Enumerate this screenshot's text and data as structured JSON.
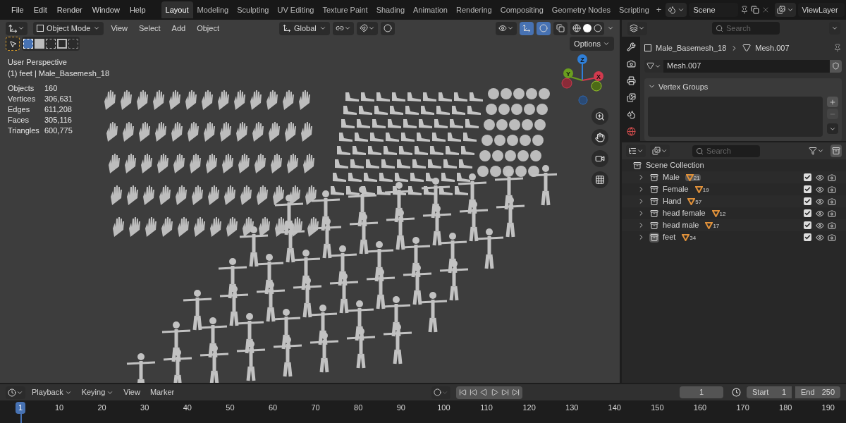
{
  "menus": [
    "File",
    "Edit",
    "Render",
    "Window",
    "Help"
  ],
  "workspaces": [
    {
      "label": "Layout",
      "selected": true
    },
    {
      "label": "Modeling",
      "selected": false
    },
    {
      "label": "Sculpting",
      "selected": false
    },
    {
      "label": "UV Editing",
      "selected": false
    },
    {
      "label": "Texture Paint",
      "selected": false
    },
    {
      "label": "Shading",
      "selected": false
    },
    {
      "label": "Animation",
      "selected": false
    },
    {
      "label": "Rendering",
      "selected": false
    },
    {
      "label": "Compositing",
      "selected": false
    },
    {
      "label": "Geometry Nodes",
      "selected": false
    },
    {
      "label": "Scripting",
      "selected": false
    }
  ],
  "add_workspace": "+",
  "scene": "Scene",
  "view_layer": "ViewLayer",
  "viewport": {
    "mode": "Object Mode",
    "menus": [
      "View",
      "Select",
      "Add",
      "Object"
    ],
    "orientation": "Global",
    "overlay": [
      "User Perspective",
      "(1) feet | Male_Basemesh_18"
    ],
    "stats": [
      {
        "label": "Objects",
        "value": "160"
      },
      {
        "label": "Vertices",
        "value": "306,631"
      },
      {
        "label": "Edges",
        "value": "611,208"
      },
      {
        "label": "Faces",
        "value": "305,116"
      },
      {
        "label": "Triangles",
        "value": "600,775"
      }
    ],
    "options": "Options",
    "gizmo_axes": [
      {
        "label": "Z",
        "color": "#2f7fd8"
      },
      {
        "label": "Y",
        "color": "#6a9e1f"
      },
      {
        "label": "X",
        "color": "#d23a4e"
      }
    ]
  },
  "properties": {
    "search": {
      "placeholder": "Search"
    },
    "object": "Male_Basemesh_18",
    "mesh": "Mesh.007",
    "data_field": "Mesh.007",
    "panel": {
      "title": "Vertex Groups",
      "expanded": true
    }
  },
  "outliner": {
    "search": {
      "placeholder": "Search"
    },
    "root": "Scene Collection",
    "collections": [
      {
        "name": "Male",
        "count": "21",
        "active": false,
        "mesh_active": true,
        "checked": true
      },
      {
        "name": "Female",
        "count": "19",
        "active": false,
        "mesh_active": false,
        "checked": true
      },
      {
        "name": "Hand",
        "count": "57",
        "active": false,
        "mesh_active": false,
        "checked": true
      },
      {
        "name": "head female",
        "count": "12",
        "active": false,
        "mesh_active": false,
        "checked": true
      },
      {
        "name": "head male",
        "count": "17",
        "active": false,
        "mesh_active": false,
        "checked": true
      },
      {
        "name": "feet",
        "count": "34",
        "active": true,
        "mesh_active": false,
        "checked": true
      }
    ]
  },
  "timeline": {
    "menus": [
      "Playback",
      "Keying",
      "View",
      "Marker"
    ],
    "current_frame": "1",
    "start_label": "Start",
    "start": "1",
    "end_label": "End",
    "end": "250",
    "ruler": [
      "1",
      "10",
      "20",
      "30",
      "40",
      "50",
      "60",
      "70",
      "80",
      "90",
      "100",
      "110",
      "120",
      "130",
      "140",
      "150",
      "160",
      "170",
      "180",
      "190"
    ]
  }
}
